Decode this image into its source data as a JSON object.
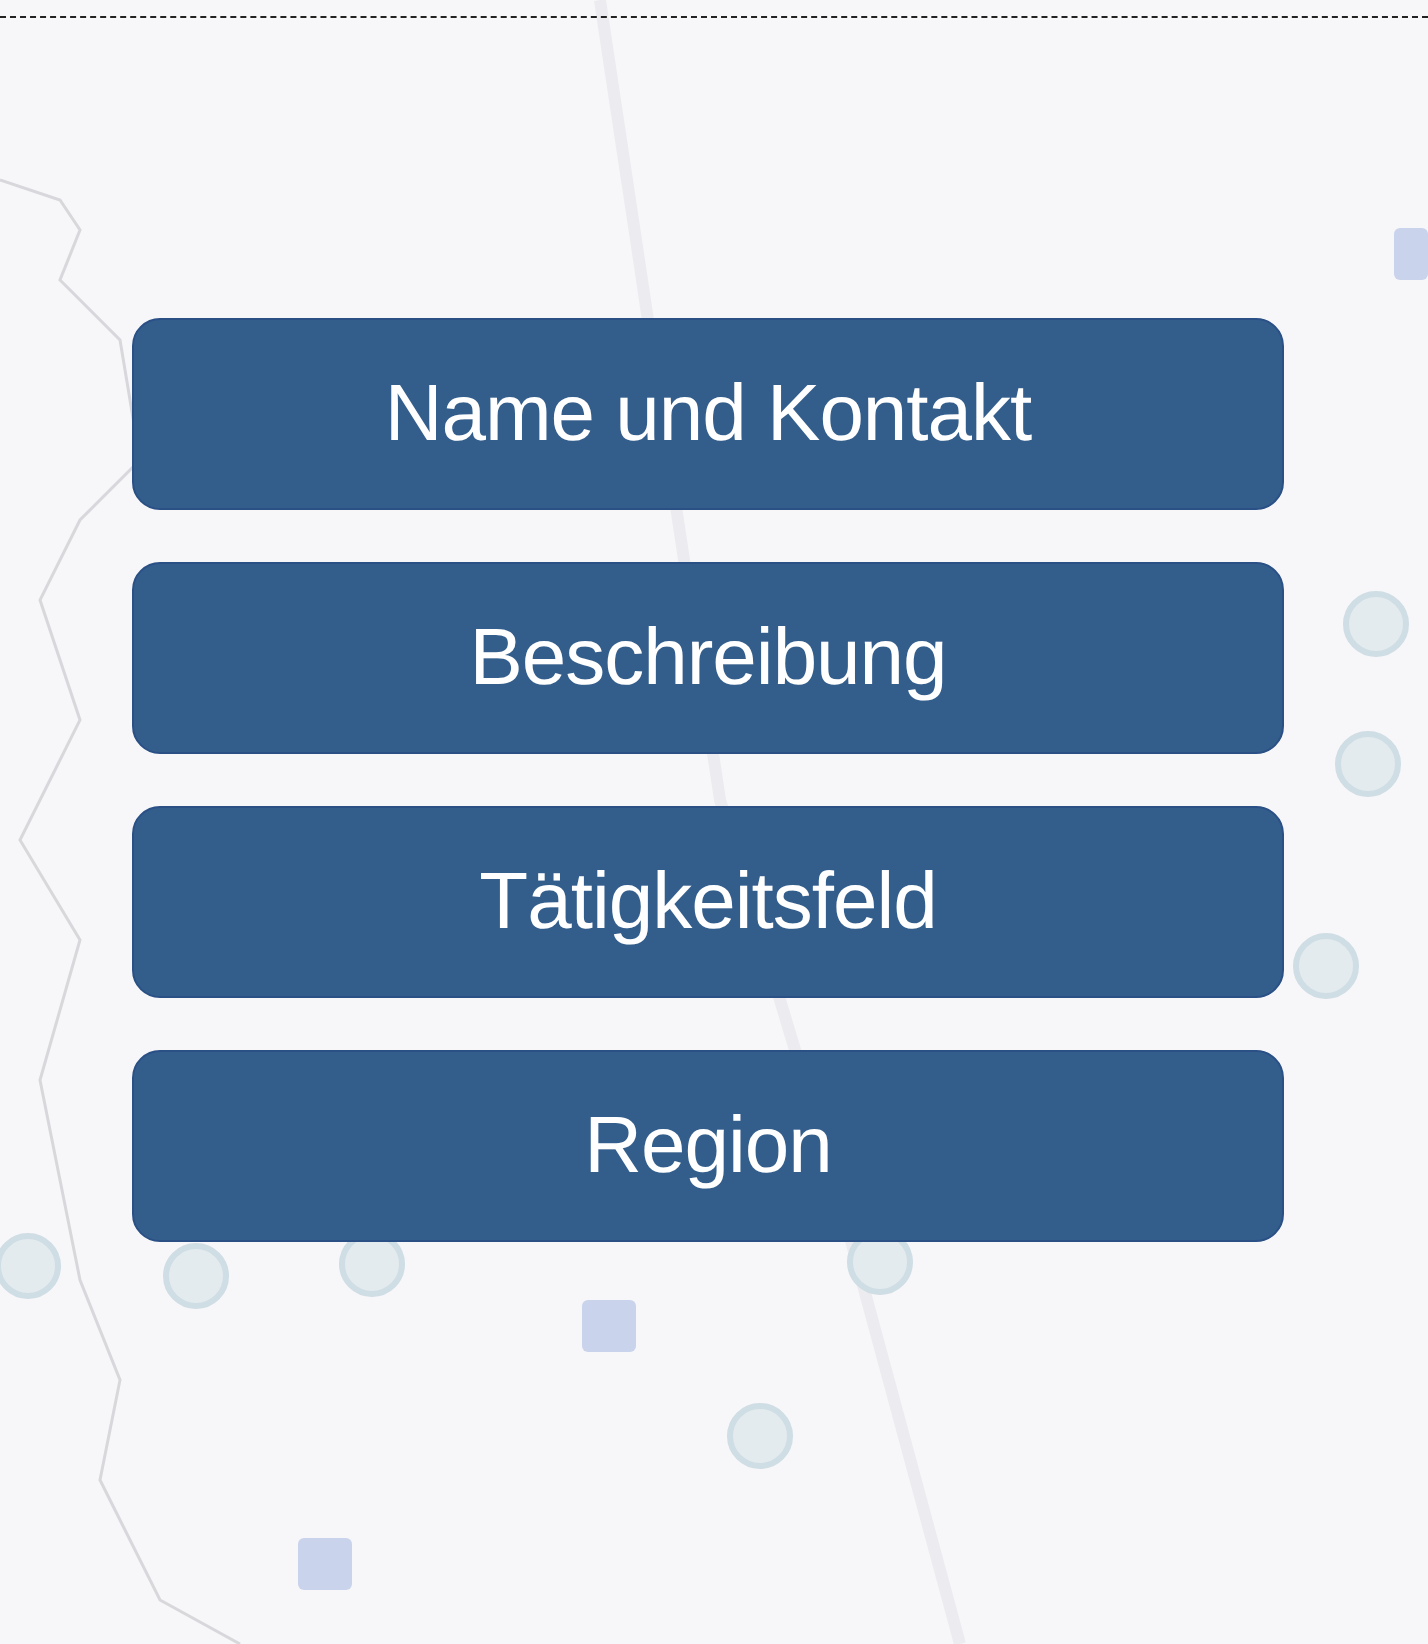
{
  "buttons": [
    {
      "label": "Name und Kontakt"
    },
    {
      "label": "Beschreibung"
    },
    {
      "label": "Tätigkeitsfeld"
    },
    {
      "label": "Region"
    }
  ]
}
